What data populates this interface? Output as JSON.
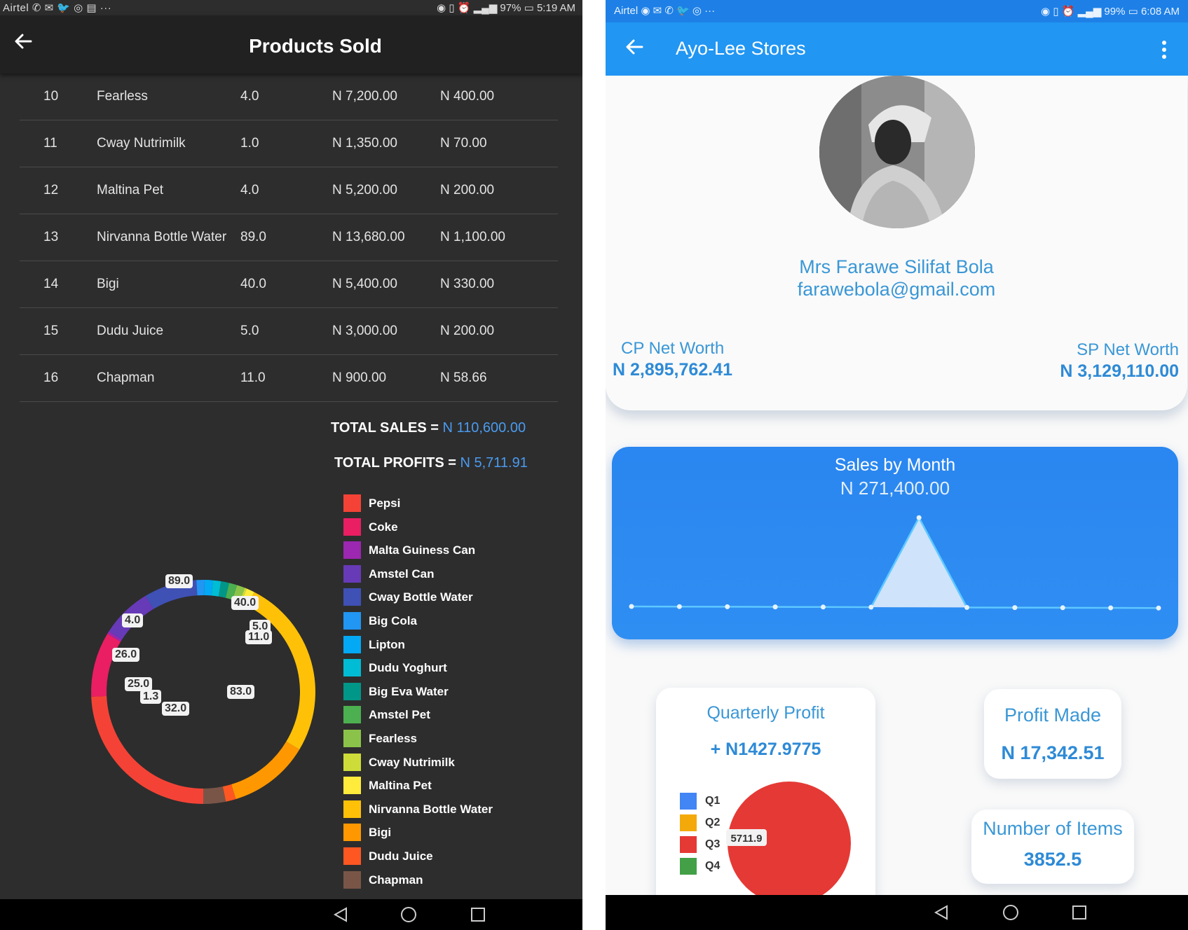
{
  "left": {
    "status_left": "Airtel ✆ ✉ 🐦 ◎ ▤ ···",
    "status_right": "◉ ▯ ⏰ ▂▄▆ 97% ▭ 5:19 AM",
    "title": "Products Sold",
    "rows": [
      {
        "no": "10",
        "name": "Fearless",
        "qty": "4.0",
        "sales": "N 7,200.00",
        "profit": "N 400.00"
      },
      {
        "no": "11",
        "name": "Cway Nutrimilk",
        "qty": "1.0",
        "sales": "N 1,350.00",
        "profit": "N 70.00"
      },
      {
        "no": "12",
        "name": "Maltina Pet",
        "qty": "4.0",
        "sales": "N 5,200.00",
        "profit": "N 200.00"
      },
      {
        "no": "13",
        "name": "Nirvanna Bottle Water",
        "qty": "89.0",
        "sales": "N 13,680.00",
        "profit": "N 1,100.00"
      },
      {
        "no": "14",
        "name": "Bigi",
        "qty": "40.0",
        "sales": "N 5,400.00",
        "profit": "N 330.00"
      },
      {
        "no": "15",
        "name": "Dudu Juice",
        "qty": "5.0",
        "sales": "N 3,000.00",
        "profit": "N 200.00"
      },
      {
        "no": "16",
        "name": "Chapman",
        "qty": "11.0",
        "sales": "N 900.00",
        "profit": "N 58.66"
      }
    ],
    "total_sales_label": "TOTAL SALES = ",
    "total_sales_value": "N 110,600.00",
    "total_profits_label": "TOTAL PROFITS = ",
    "total_profits_value": "N 5,711.91"
  },
  "chart_data": [
    {
      "type": "pie",
      "variant": "donut",
      "legend": [
        "Pepsi",
        "Coke",
        "Malta Guiness Can",
        "Amstel Can",
        "Cway Bottle Water",
        "Big Cola",
        "Lipton",
        "Dudu Yoghurt",
        "Big Eva Water",
        "Amstel Pet",
        "Fearless",
        "Cway Nutrimilk",
        "Maltina Pet",
        "Nirvanna Bottle Water",
        "Bigi",
        "Dudu Juice",
        "Chapman"
      ],
      "colors": [
        "#f44336",
        "#e91e63",
        "#9c27b0",
        "#673ab7",
        "#3f51b5",
        "#2196f3",
        "#03a9f4",
        "#00bcd4",
        "#009688",
        "#4caf50",
        "#8bc34a",
        "#cddc39",
        "#ffeb3b",
        "#ffc107",
        "#ff9800",
        "#ff5722",
        "#795548"
      ],
      "values": [
        83.0,
        32.0,
        1.3,
        25.0,
        26.0,
        4.0,
        4.0,
        4.0,
        4.0,
        4.0,
        4.0,
        1.0,
        4.0,
        89.0,
        40.0,
        5.0,
        11.0
      ],
      "data_labels": [
        "89.0",
        "40.0",
        "4.0",
        "5.0",
        "11.0",
        "26.0",
        "25.0",
        "1.3",
        "32.0",
        "83.0"
      ]
    },
    {
      "type": "area",
      "title": "Sales by Month",
      "subtitle": "N 271,400.00",
      "x": [
        1,
        2,
        3,
        4,
        5,
        6,
        7,
        8,
        9,
        10,
        11,
        12
      ],
      "values": [
        0,
        0,
        0,
        0,
        0,
        0,
        271400,
        0,
        0,
        0,
        0,
        0
      ],
      "colors": {
        "line": "#5ec8ff",
        "fill": "#cfe3fa",
        "background": "#2f8ef2"
      }
    },
    {
      "type": "pie",
      "title": "Quarterly Profit",
      "legend": [
        "Q1",
        "Q2",
        "Q3",
        "Q4"
      ],
      "colors": [
        "#4285f4",
        "#f4a90b",
        "#e53935",
        "#43a047"
      ],
      "values": [
        0,
        0,
        5711.9,
        0
      ],
      "data_labels": [
        "5711.9"
      ]
    }
  ],
  "right": {
    "status_left": "Airtel ◉ ✉ ✆ 🐦 ◎ ···",
    "status_right": "◉ ▯ ⏰ ▂▄▆ 99% ▭ 6:08 AM",
    "title": "Ayo-Lee Stores",
    "name": "Mrs Farawe Silifat Bola",
    "email": "farawebola@gmail.com",
    "cp_label": "CP Net Worth",
    "cp_value": "N 2,895,762.41",
    "sp_label": "SP Net Worth",
    "sp_value": "N 3,129,110.00",
    "sales_title": "Sales by Month",
    "sales_value": "N 271,400.00",
    "qp_title": "Quarterly Profit",
    "qp_value": "+ N1427.9775",
    "pm_title": "Profit Made",
    "pm_value": "N 17,342.51",
    "ni_title": "Number of Items",
    "ni_value": "3852.5"
  }
}
